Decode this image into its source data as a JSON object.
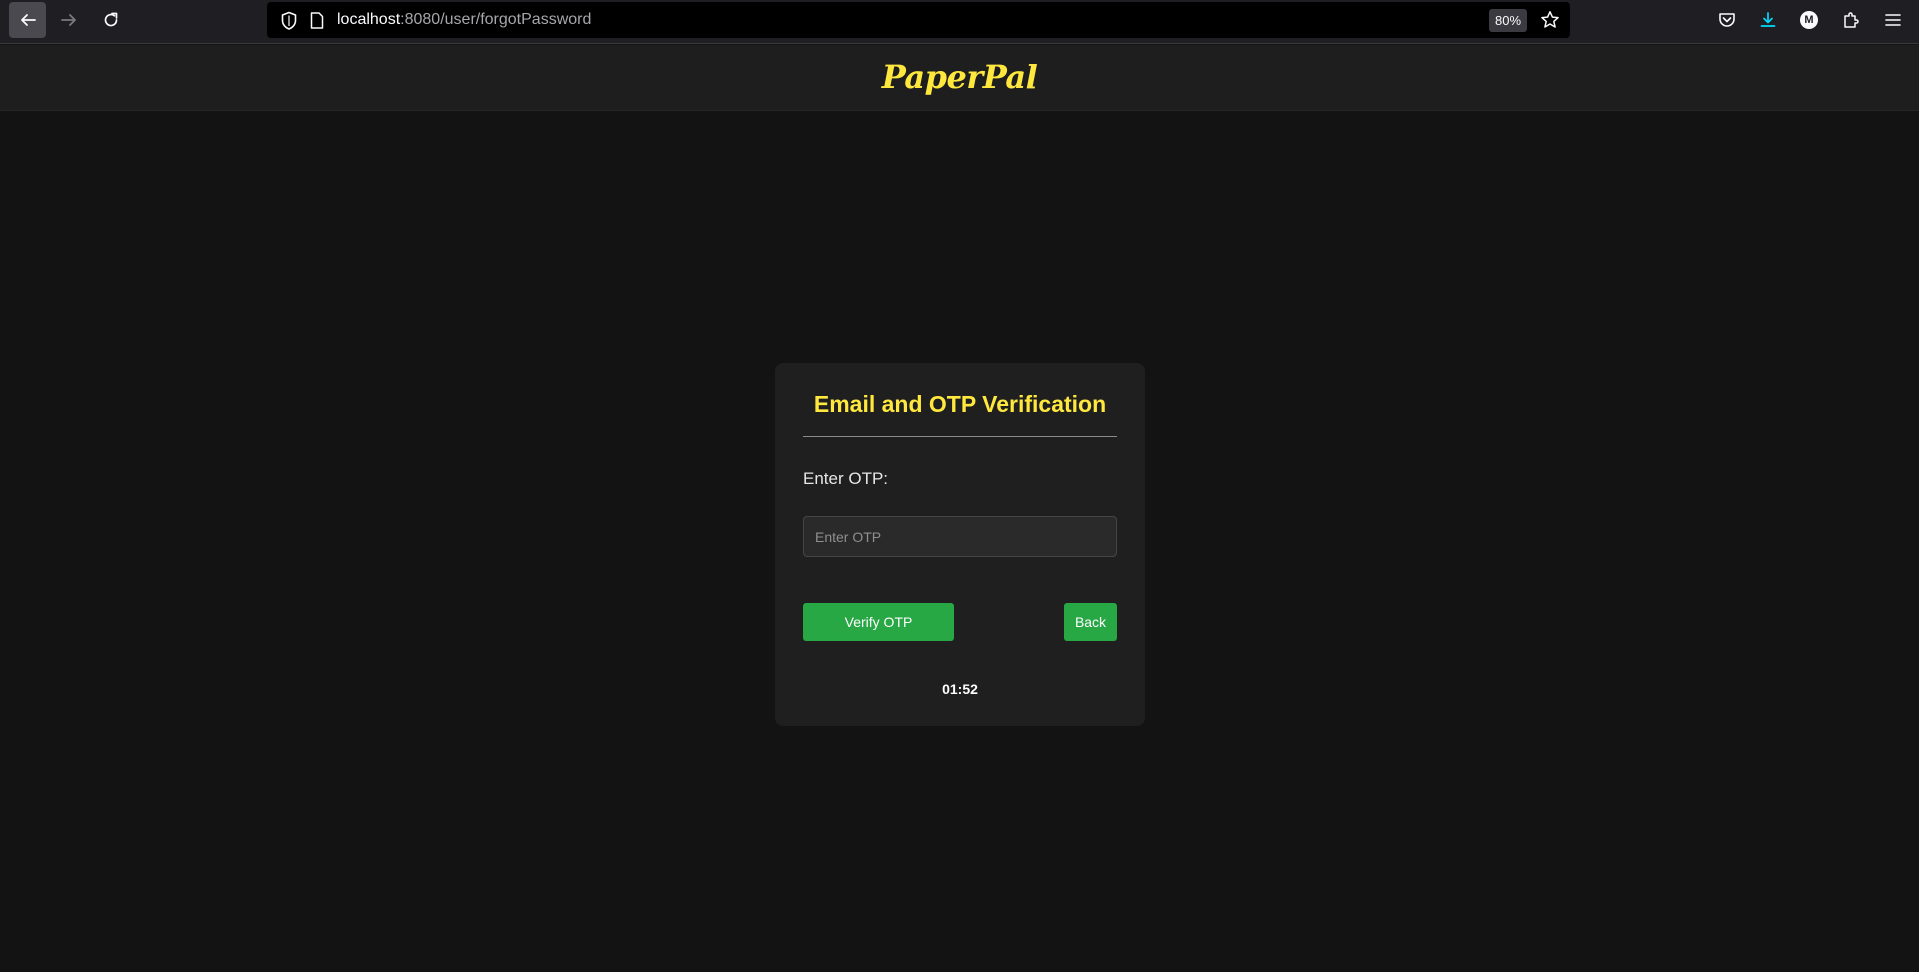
{
  "browser": {
    "url_host": "localhost",
    "url_path": ":8080/user/forgotPassword",
    "zoom": "80%",
    "account_initial": "M",
    "icons": [
      "back-arrow-icon",
      "forward-arrow-icon",
      "reload-icon",
      "shield-icon",
      "page-icon",
      "star-icon",
      "pocket-icon",
      "download-icon",
      "extensions-icon",
      "menu-icon"
    ],
    "colors": {
      "download_icon": "#00ddff"
    }
  },
  "site": {
    "brand": "PaperPal",
    "colors": {
      "brand": "#ffe83d",
      "button": "#28a745"
    }
  },
  "form": {
    "title": "Email and OTP Verification",
    "otp_label": "Enter OTP:",
    "otp_placeholder": "Enter OTP",
    "otp_value": "",
    "verify_label": "Verify OTP",
    "back_label": "Back",
    "timer": "01:52"
  }
}
